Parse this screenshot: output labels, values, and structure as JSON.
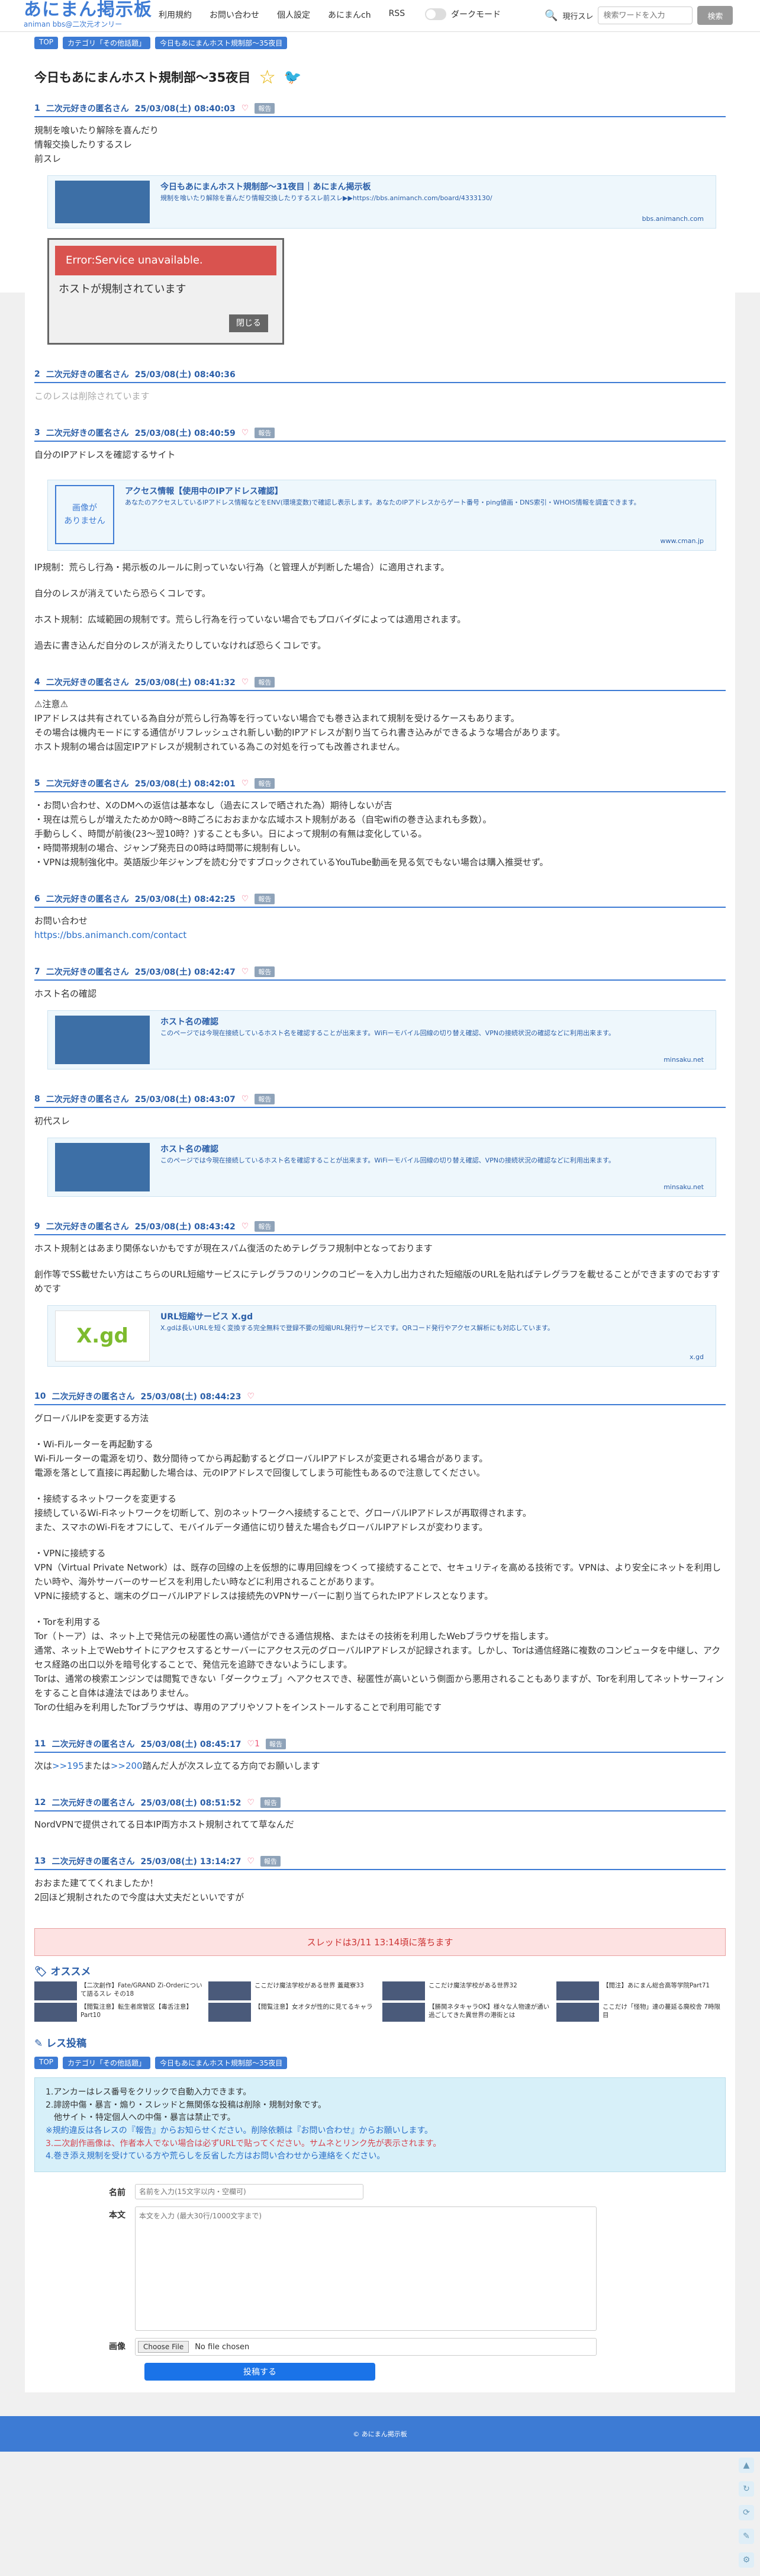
{
  "header": {
    "logo": "あにまん掲示板",
    "logo_sub": "animan bbs@二次元オンリー",
    "nav": [
      "利用規約",
      "お問い合わせ",
      "個人設定",
      "あにまんch",
      "RSS"
    ],
    "dark_mode": "ダークモード",
    "search_scope": "現行スレ",
    "search_placeholder": "検索ワードを入力",
    "search_button": "検索"
  },
  "breadcrumbs": [
    "TOP",
    "カテゴリ「その他話題」",
    "今日もあにまんホスト規制部〜35夜目"
  ],
  "thread_title": "今日もあにまんホスト規制部〜35夜目",
  "posts": [
    {
      "no": "1",
      "name": "二次元好きの匿名さん",
      "date": "25/03/08(土) 08:40:03",
      "report": "報告",
      "lines": [
        "規制を喰いたり解除を喜んだり",
        "情報交換したりするスレ",
        "前スレ"
      ],
      "card": {
        "title": "今日もあにまんホスト規制部〜31夜目｜あにまん掲示板",
        "desc": "規制を喰いたり解除を喜んだり情報交換したりするスレ前スレ▶▶https://bbs.animanch.com/board/4333130/",
        "domain": "bbs.animanch.com"
      },
      "image": {
        "error": "Error:Service unavailable.",
        "message": "ホストが規制されています",
        "close": "閉じる"
      }
    },
    {
      "no": "2",
      "name": "二次元好きの匿名さん",
      "date": "25/03/08(土) 08:40:36",
      "deleted": "このレスは削除されています"
    },
    {
      "no": "3",
      "name": "二次元好きの匿名さん",
      "date": "25/03/08(土) 08:40:59",
      "report": "報告",
      "lines": [
        "自分のIPアドレスを確認するサイト"
      ],
      "card": {
        "noimg": "画像が\nありません",
        "title": "アクセス情報【使用中のIPアドレス確認】",
        "desc": "あなたのアクセスしているIPアドレス情報などをENV(環境変数)で確認し表示します。あなたのIPアドレスからゲート番号・ping値画・DNS索引・WHOIS情報を調査できます。",
        "domain": "www.cman.jp"
      },
      "after": [
        "IP規制：荒らし行為・掲示板のルールに則っていない行為（と管理人が判断した場合）に適用されます。",
        "",
        "自分のレスが消えていたら恐らくコレです。",
        "",
        "ホスト規制：広域範囲の規制です。荒らし行為を行っていない場合でもプロバイダによっては適用されます。",
        "",
        "過去に書き込んだ自分のレスが消えたりしていなければ恐らくコレです。"
      ]
    },
    {
      "no": "4",
      "name": "二次元好きの匿名さん",
      "date": "25/03/08(土) 08:41:32",
      "report": "報告",
      "lines": [
        "⚠注意⚠",
        "IPアドレスは共有されている為自分が荒らし行為等を行っていない場合でも巻き込まれて規制を受けるケースもあります。",
        "その場合は機内モードにする通信がリフレッシュされ新しい動的IPアドレスが割り当てられ書き込みができるような場合があります。",
        "ホスト規制の場合は固定IPアドレスが規制されている為この対処を行っても改善されません。"
      ]
    },
    {
      "no": "5",
      "name": "二次元好きの匿名さん",
      "date": "25/03/08(土) 08:42:01",
      "report": "報告",
      "lines": [
        "・お問い合わせ、XのDMへの返信は基本なし（過去にスレで晒された為）期待しないが吉",
        "・現在は荒らしが増えたためか0時〜8時ごろにおおまかな広域ホスト規制がある（自宅wifiの巻き込まれも多数）。",
        "手動らしく、時間が前後(23〜翌10時？)することも多い。日によって規制の有無は変化している。",
        "・時間帯規制の場合、ジャンプ発売日の0時は時間帯に規制有しい。",
        "・VPNは規制強化中。英語版少年ジャンプを読む分ですブロックされているYouTube動画を見る気でもない場合は購入推奨せず。"
      ]
    },
    {
      "no": "6",
      "name": "二次元好きの匿名さん",
      "date": "25/03/08(土) 08:42:25",
      "report": "報告",
      "lines": [
        "お問い合わせ"
      ],
      "link": "https://bbs.animanch.com/contact"
    },
    {
      "no": "7",
      "name": "二次元好きの匿名さん",
      "date": "25/03/08(土) 08:42:47",
      "report": "報告",
      "lines": [
        "ホスト名の確認"
      ],
      "card": {
        "title": "ホスト名の確認",
        "desc": "このページでは今現在接続しているホスト名を確認することが出来ます。WiFiーモバイル回線の切り替え確認、VPNの接続状況の確認などに利用出来ます。",
        "domain": "minsaku.net"
      }
    },
    {
      "no": "8",
      "name": "二次元好きの匿名さん",
      "date": "25/03/08(土) 08:43:07",
      "report": "報告",
      "lines": [
        "初代スレ"
      ],
      "card": {
        "title": "ホスト名の確認",
        "desc": "このページでは今現在接続しているホスト名を確認することが出来ます。WiFiーモバイル回線の切り替え確認、VPNの接続状況の確認などに利用出来ます。",
        "domain": "minsaku.net"
      }
    },
    {
      "no": "9",
      "name": "二次元好きの匿名さん",
      "date": "25/03/08(土) 08:43:42",
      "report": "報告",
      "lines": [
        "ホスト規制とはあまり関係ないかもですが現在スパム復活のためテレグラフ規制中となっております",
        "",
        "創作等でSS載せたい方はこちらのURL短縮サービスにテレグラフのリンクのコピーを入力し出力された短縮版のURLを貼ればテレグラフを載せることができますのでおすすめです"
      ],
      "card": {
        "logo": "X.gd",
        "title": "URL短縮サービス X.gd",
        "desc": "X.gdは長いURLを短く変換する完全無料で登録不要の短縮URL発行サービスです。QRコード発行やアクセス解析にも対応しています。",
        "domain": "x.gd"
      }
    },
    {
      "no": "10",
      "name": "二次元好きの匿名さん",
      "date": "25/03/08(土) 08:44:23",
      "lines": [
        "グローバルIPを変更する方法",
        "",
        "・Wi-Fiルーターを再起動する",
        "Wi-Fiルーターの電源を切り、数分間待ってから再起動するとグローバルIPアドレスが変更される場合があります。",
        "電源を落として直接に再起動した場合は、元のIPアドレスで回復してしまう可能性もあるので注意してください。",
        "",
        "・接続するネットワークを変更する",
        "接続しているWi-Fiネットワークを切断して、別のネットワークへ接続することで、グローバルIPアドレスが再取得されます。",
        "また、スマホのWi-Fiをオフにして、モバイルデータ通信に切り替えた場合もグローバルIPアドレスが変わります。",
        "",
        "・VPNに接続する",
        "VPN（Virtual Private Network）は、既存の回線の上を仮想的に専用回線をつくって接続することで、セキュリティを高める技術です。VPNは、より安全にネットを利用したい時や、海外サーバーのサービスを利用したい時などに利用されることがあります。",
        "VPNに接続すると、端末のグローバルIPアドレスは接続先のVPNサーバーに割り当てられたIPアドレスとなります。",
        "",
        "・Torを利用する",
        "Tor（トーア）は、ネット上で発信元の秘匿性の高い通信ができる通信規格、またはその技術を利用したWebブラウザを指します。",
        "通常、ネット上でWebサイトにアクセスするとサーバーにアクセス元のグローバルIPアドレスが記録されます。しかし、Torは通信経路に複数のコンピュータを中継し、アクセス経路の出口以外を暗号化することで、発信元を追跡できないようにします。",
        "Torは、通常の検索エンジンでは閲覧できない「ダークウェブ」へアクセスでき、秘匿性が高いという側面から悪用されることもありますが、Torを利用してネットサーフィンをすること自体は違法ではありません。",
        "Torの仕組みを利用したTorブラウザは、専用のアプリやソフトをインストールすることで利用可能です"
      ]
    },
    {
      "no": "11",
      "name": "二次元好きの匿名さん",
      "date": "25/03/08(土) 08:45:17",
      "likes": "1",
      "report": "報告",
      "mixed": {
        "a": "次は",
        "r1": ">>195",
        "b": "または",
        "r2": ">>200",
        "c": "踏んだ人が次スレ立てる方向でお願いします"
      }
    },
    {
      "no": "12",
      "name": "二次元好きの匿名さん",
      "date": "25/03/08(土) 08:51:52",
      "report": "報告",
      "lines": [
        "NordVPNで提供されてる日本IP両方ホスト規制されてて草なんだ"
      ]
    },
    {
      "no": "13",
      "name": "二次元好きの匿名さん",
      "date": "25/03/08(土) 13:14:27",
      "report": "報告",
      "lines": [
        "おおまた建ててくれましたか！",
        "2回ほど規制されたので今度は大丈夫だといいですが"
      ]
    }
  ],
  "thread_ended": "スレッドは3/11 13:14頃に落ちます",
  "recommend": {
    "title": "オススメ",
    "items": [
      "【二次創作】Fate/GRAND Zi-Orderについて語るスレ その18",
      "ここだけ魔法学校がある世界 蓋蔵寮33",
      "ここだけ魔法学校がある世界32",
      "【閲注】あにまん総合高等学院Part71",
      "【閲覧注意】転生者席管区【毒舌注意】Part10",
      "【閲覧注意】女オタが性的に見てるキャラ",
      "【勝鬨ネタキャラOK】様々な人物達が通い過ごしてきた異世界の港街とは",
      "ここだけ「怪物」達の蔓延る廃校舎 7時限目"
    ]
  },
  "reply": {
    "title": "レス投稿",
    "notice": [
      {
        "t": "1.アンカーはレス番号をクリックで自動入力できます。",
        "c": ""
      },
      {
        "t": "2.誹謗中傷・暴言・煽り・スレッドと無関係な投稿は削除・規制対象です。",
        "c": ""
      },
      {
        "t": "　他サイト・特定個人への中傷・暴言は禁止です。",
        "c": ""
      },
      {
        "t": "※規約違反は各レスの『報告』からお知らせください。削除依頼は『お問い合わせ』からお願いします。",
        "c": "blue"
      },
      {
        "t": "3.二次創作画像は、作者本人でない場合は必ずURLで貼ってください。サムネとリンク先が表示されます。",
        "c": "red"
      },
      {
        "t": "4.巻き添え規制を受けている方や荒らしを反省した方はお問い合わせから連絡をください。",
        "c": "blue"
      }
    ],
    "name_label": "名前",
    "name_placeholder": "名前を入力(15文字以内・空欄可)",
    "body_label": "本文",
    "body_placeholder": "本文を入力 (最大30行/1000文字まで)",
    "image_label": "画像",
    "file_button": "Choose File",
    "file_status": "No file chosen",
    "submit": "投稿する"
  },
  "footer": "© あにまん掲示板"
}
